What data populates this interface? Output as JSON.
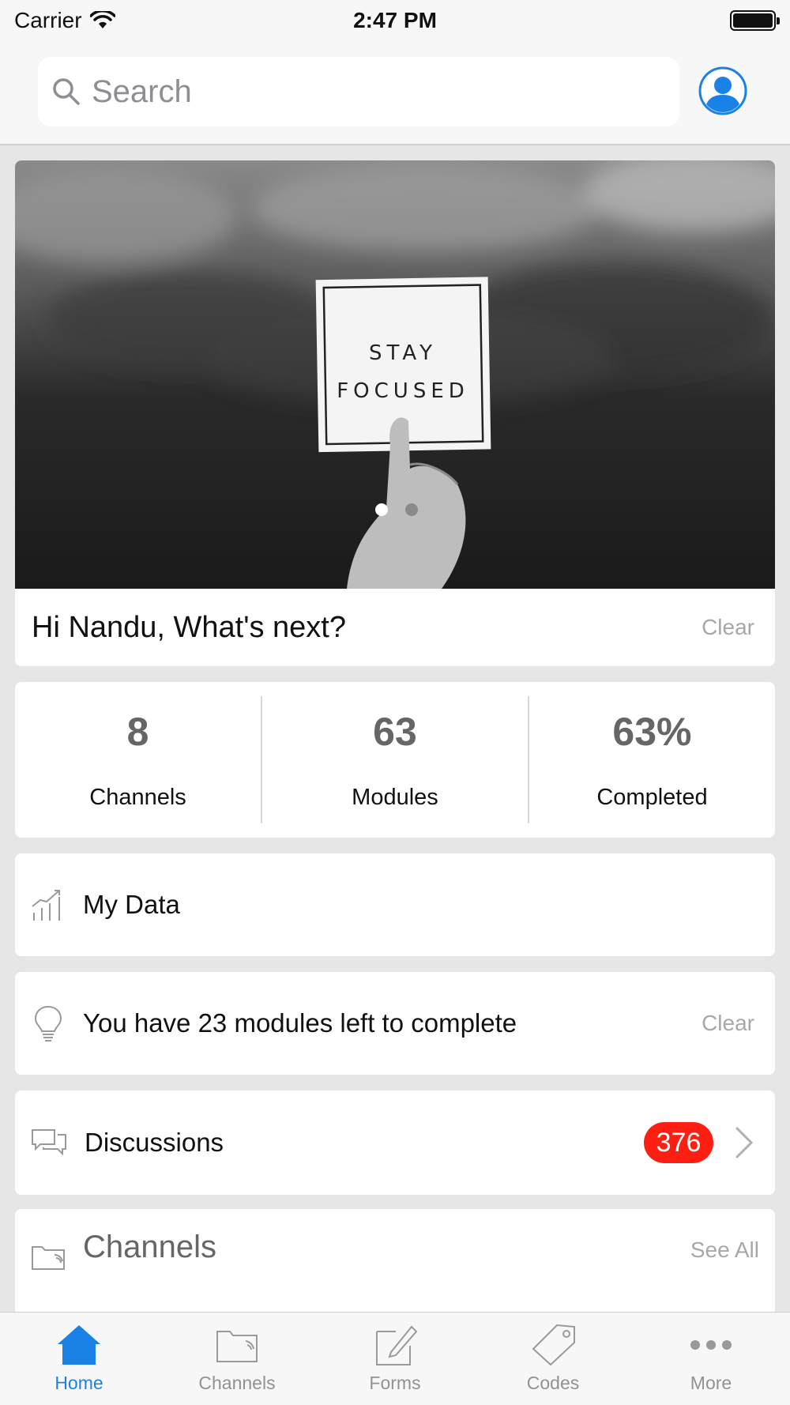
{
  "status_bar": {
    "carrier": "Carrier",
    "time": "2:47 PM"
  },
  "search": {
    "placeholder": "Search"
  },
  "hero": {
    "sign_text_line1": "STAY",
    "sign_text_line2": "FOCUSED",
    "greeting": "Hi Nandu, What's next?",
    "clear_label": "Clear",
    "page_count": 2,
    "active_page": 1
  },
  "stats": [
    {
      "value": "8",
      "label": "Channels"
    },
    {
      "value": "63",
      "label": "Modules"
    },
    {
      "value": "63%",
      "label": "Completed"
    }
  ],
  "my_data": {
    "label": "My Data",
    "icon": "bar-chart-icon"
  },
  "tip": {
    "label": "You have 23 modules left to complete",
    "clear_label": "Clear",
    "icon": "lightbulb-icon"
  },
  "discussions": {
    "label": "Discussions",
    "badge": "376",
    "icon": "chat-bubbles-icon"
  },
  "channels_section": {
    "label": "Channels",
    "see_all": "See All",
    "icon": "folder-icon"
  },
  "tabs": [
    {
      "label": "Home",
      "icon": "home-icon",
      "active": true
    },
    {
      "label": "Channels",
      "icon": "folder-icon",
      "active": false
    },
    {
      "label": "Forms",
      "icon": "pencil-icon",
      "active": false
    },
    {
      "label": "Codes",
      "icon": "tag-icon",
      "active": false
    },
    {
      "label": "More",
      "icon": "more-dots-icon",
      "active": false
    }
  ],
  "colors": {
    "accent": "#1a82e6",
    "badge": "#ff1e12",
    "muted": "#a8a8a8"
  }
}
